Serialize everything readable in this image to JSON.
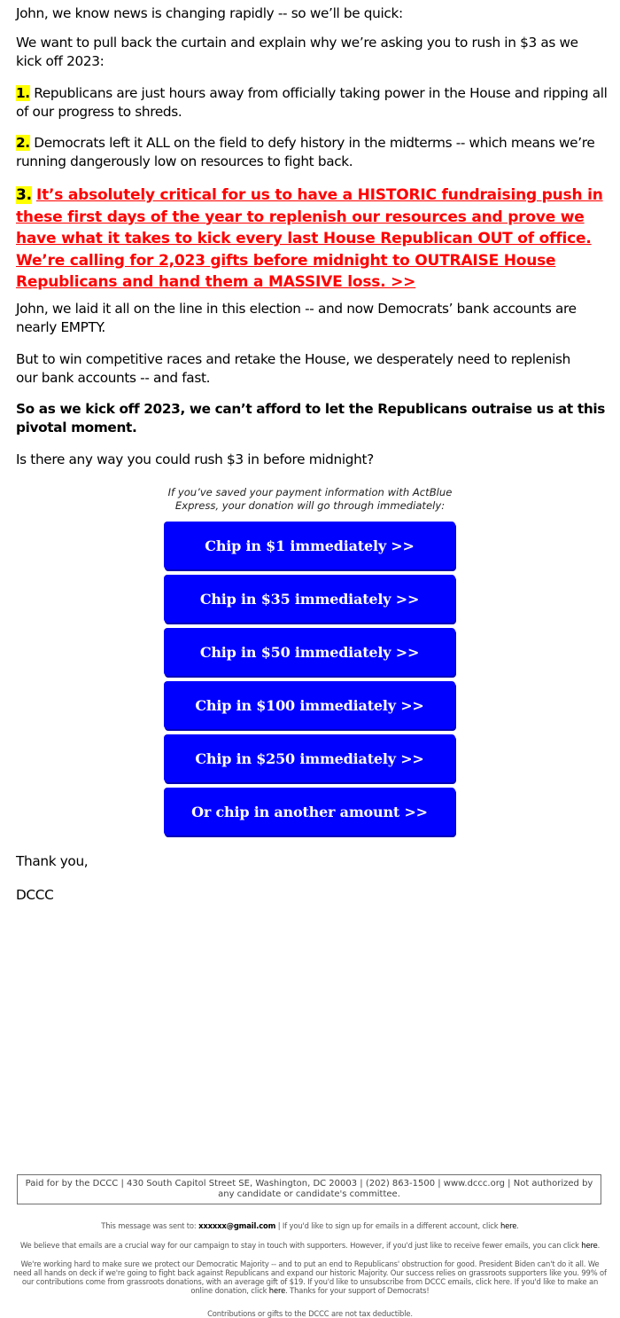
{
  "body": {
    "p1": "John, we know news is changing rapidly -- so we’ll be quick:",
    "p2": "We want to pull back the curtain and explain why we’re asking you to rush in $3 as we kick off 2023:",
    "item1_num": "1.",
    "item1_text": " Republicans are just hours away from officially taking power in the House and ripping all of our progress to shreds.",
    "item2_num": "2.",
    "item2_text": " Democrats left it ALL on the field to defy history in the midterms -- which means we’re running dangerously low on resources to fight back.",
    "item3_num": "3.",
    "item3_link": "It’s absolutely critical for us to have a HISTORIC fundraising push in these first days of the year to replenish our resources and prove we have what it takes to kick every last House Republican OUT of office. We’re calling for 2,023 gifts before midnight to OUTRAISE House Republicans and hand them a MASSIVE loss. >>",
    "p3": "John, we laid it all on the line in this election -- and now Democrats’ bank accounts are nearly EMPTY.",
    "p4": "But to win competitive races and retake the House, we desperately need to replenish our bank accounts -- and fast.",
    "p5_bold": "So as we kick off 2023, we can’t afford to let the Republicans outraise us at this pivotal moment.",
    "p6": "Is there any way you could rush $3 in before midnight?"
  },
  "donate": {
    "note": "If you’ve saved your payment information with ActBlue Express, your donation will go through immediately:",
    "buttons": [
      "Chip in $1 immediately >>",
      "Chip in $35 immediately >>",
      "Chip in $50 immediately >>",
      "Chip in $100 immediately >>",
      "Chip in $250 immediately >>",
      "Or chip in another amount >>"
    ],
    "button_color": "#0000ff"
  },
  "signoff": {
    "thanks": "Thank you,",
    "sender": "DCCC"
  },
  "footer": {
    "disclaimer": "Paid for by the DCCC | 430 South Capitol Street SE, Washington, DC 20003 | (202) 863-1500 | www.dccc.org | Not authorized by any candidate or candidate's committee.",
    "sent_to_prefix": "This message was sent to: ",
    "email": "xxxxxx@gmail.com",
    "sent_to_suffix": " | If you'd like to sign up for emails in a different account, click ",
    "here": "here",
    "period": ".",
    "believe": "We believe that emails are a crucial way for our campaign to stay in touch with supporters. However, if you'd just like to receive fewer emails, you can click ",
    "working": "We're working hard to make sure we protect our Democratic Majority -- and to put an end to Republicans' obstruction for good. President Biden can't do it all. We need all hands on deck if we're going to fight back against Republicans and expand our historic Majority. Our success relies on grassroots supporters like you. 99% of our contributions come from grassroots donations, with an average gift of $19. If you'd like to unsubscribe from DCCC emails, click here. If you'd like to make an online donation, click ",
    "working_end": ". Thanks for your support of Democrats!",
    "tax": "Contributions or gifts to the DCCC are not tax deductible."
  }
}
